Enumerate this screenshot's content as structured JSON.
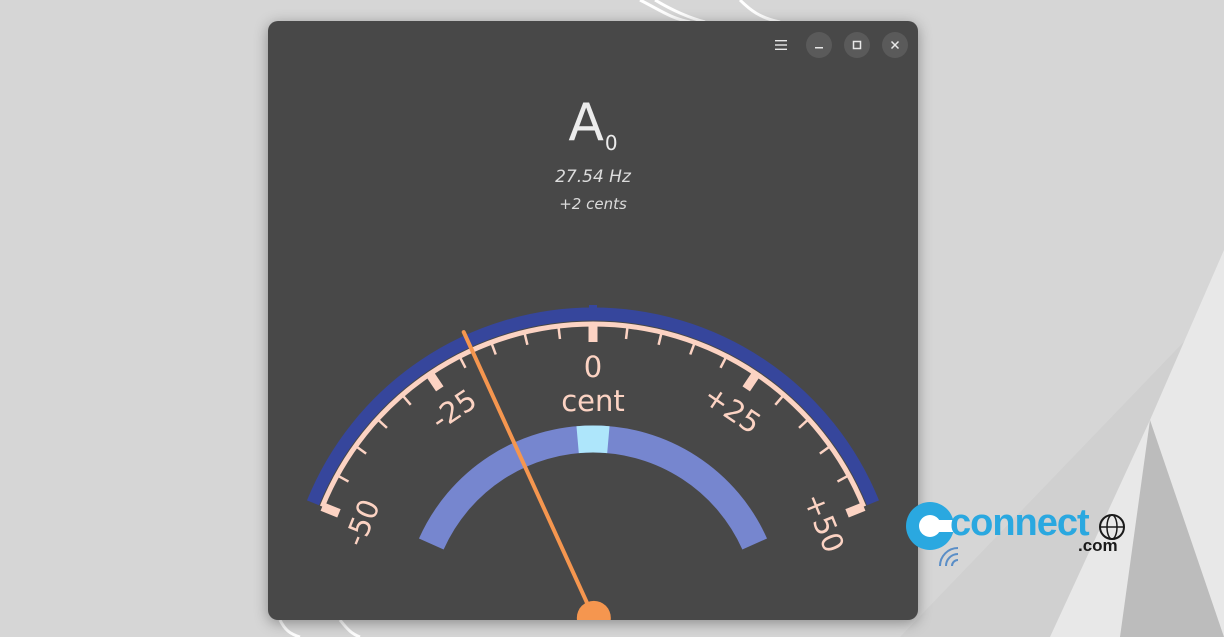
{
  "window": {
    "menu_icon": "hamburger-menu-icon",
    "minimize_icon": "minimize-icon",
    "maximize_icon": "maximize-icon",
    "close_icon": "close-icon"
  },
  "tuner": {
    "note": "A",
    "octave": "0",
    "frequency": "27.54 Hz",
    "cents_offset": "+2 cents"
  },
  "gauge": {
    "unit_label": "cent",
    "tick_labels": [
      "-50",
      "-25",
      "0",
      "+25",
      "+50"
    ],
    "min": -50,
    "max": 50,
    "needle_value": -18,
    "in_tune_band": [
      -3,
      3
    ]
  },
  "colors": {
    "window_bg": "#484848",
    "outer_arc": "#36469c",
    "scale": "#fcd3c3",
    "inner_arc": "#7686cf",
    "in_tune": "#aee6fb",
    "needle": "#f5964f"
  },
  "watermark": {
    "brand": "connect",
    "suffix": ".com"
  }
}
